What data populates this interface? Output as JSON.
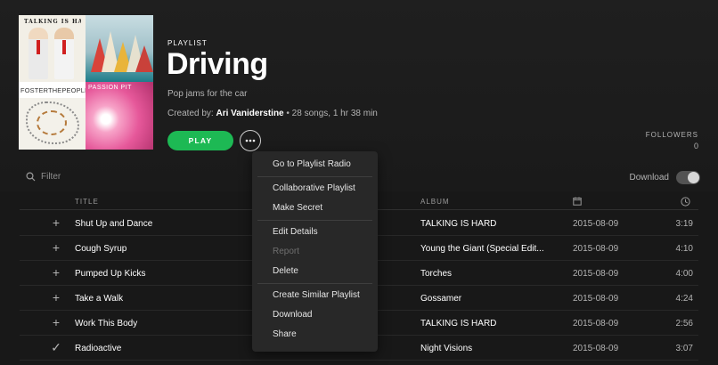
{
  "playlist": {
    "type_label": "PLAYLIST",
    "title": "Driving",
    "description": "Pop jams for the car",
    "created_prefix": "Created by: ",
    "creator": "Ari Vaniderstine",
    "stats": " • 28 songs, 1 hr 38 min",
    "play_label": "PLAY",
    "more_label": "•••",
    "followers_label": "FOLLOWERS",
    "followers_count": "0"
  },
  "cover": {
    "tile1_text": "TALKING IS HARD",
    "tile3_text": "FOSTERTHEPEOPLE",
    "tile4_text": "PASSION PIT"
  },
  "toolbar": {
    "filter_placeholder": "Filter",
    "download_label": "Download"
  },
  "table": {
    "headers": {
      "title": "TITLE",
      "album": "ALBUM"
    },
    "rows": [
      {
        "mark": "+",
        "title": "Shut Up and Dance",
        "album": "TALKING IS HARD",
        "date": "2015-08-09",
        "duration": "3:19"
      },
      {
        "mark": "+",
        "title": "Cough Syrup",
        "album": "Young the Giant (Special Edit...",
        "date": "2015-08-09",
        "duration": "4:10"
      },
      {
        "mark": "+",
        "title": "Pumped Up Kicks",
        "album": "Torches",
        "date": "2015-08-09",
        "duration": "4:00"
      },
      {
        "mark": "+",
        "title": "Take a Walk",
        "album": "Gossamer",
        "date": "2015-08-09",
        "duration": "4:24"
      },
      {
        "mark": "+",
        "title": "Work This Body",
        "album": "TALKING IS HARD",
        "date": "2015-08-09",
        "duration": "2:56"
      },
      {
        "mark": "✓",
        "title": "Radioactive",
        "album": "Night Visions",
        "date": "2015-08-09",
        "duration": "3:07"
      }
    ]
  },
  "context_menu": {
    "items": [
      {
        "label": "Go to Playlist Radio",
        "enabled": true
      },
      {
        "label": "Collaborative Playlist",
        "enabled": true
      },
      {
        "label": "Make Secret",
        "enabled": true
      },
      {
        "label": "Edit Details",
        "enabled": true
      },
      {
        "label": "Report",
        "enabled": false
      },
      {
        "label": "Delete",
        "enabled": true
      },
      {
        "label": "Create Similar Playlist",
        "enabled": true
      },
      {
        "label": "Download",
        "enabled": true
      },
      {
        "label": "Share",
        "enabled": true
      }
    ]
  },
  "colors": {
    "accent": "#1db954",
    "background": "#181818",
    "menu_bg": "#282828"
  }
}
